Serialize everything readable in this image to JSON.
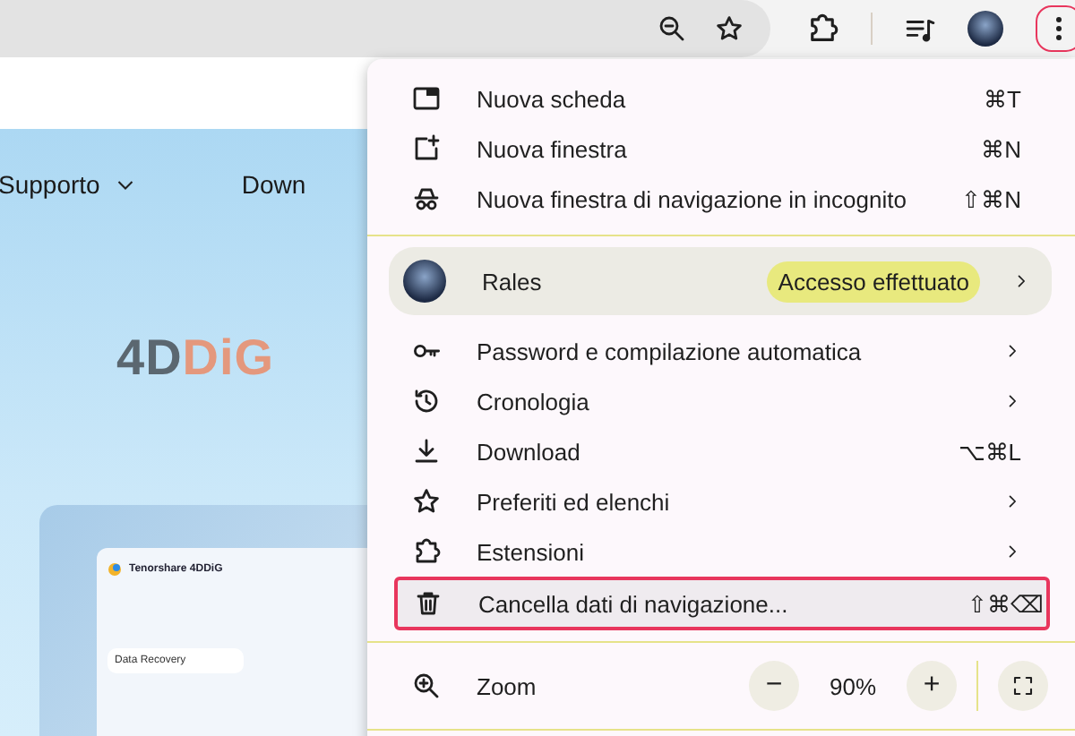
{
  "toolbar": {
    "menu_button": {
      "highlighted": true
    }
  },
  "page": {
    "nav": [
      {
        "label": "Supporto",
        "dropdown": true
      },
      {
        "label": "Down",
        "dropdown": false
      }
    ],
    "logo": {
      "dark": "4D",
      "accent": "DiG"
    },
    "preview": {
      "app_title": "Tenorshare 4DDiG",
      "tile_label": "Data Recovery"
    }
  },
  "menu": {
    "items": [
      {
        "kind": "item",
        "label": "Nuova scheda",
        "shortcut": "⌘T",
        "submenu": false,
        "highlighted": false
      },
      {
        "kind": "item",
        "label": "Nuova finestra",
        "shortcut": "⌘N",
        "submenu": false,
        "highlighted": false
      },
      {
        "kind": "item",
        "label": "Nuova finestra di navigazione in incognito",
        "shortcut": "⇧⌘N",
        "submenu": false,
        "highlighted": false
      },
      {
        "kind": "divider"
      },
      {
        "kind": "profile",
        "label": "Rales",
        "badge": "Accesso effettuato",
        "submenu": true
      },
      {
        "kind": "item",
        "label": "Password e compilazione automatica",
        "submenu": true,
        "highlighted": false
      },
      {
        "kind": "item",
        "label": "Cronologia",
        "submenu": true,
        "highlighted": false
      },
      {
        "kind": "item",
        "label": "Download",
        "shortcut": "⌥⌘L",
        "submenu": false,
        "highlighted": false
      },
      {
        "kind": "item",
        "label": "Preferiti ed elenchi",
        "submenu": true,
        "highlighted": false
      },
      {
        "kind": "item",
        "label": "Estensioni",
        "submenu": true,
        "highlighted": false
      },
      {
        "kind": "item",
        "label": "Cancella dati di navigazione...",
        "shortcut": "⇧⌘⌫",
        "submenu": false,
        "highlighted": true
      },
      {
        "kind": "divider"
      },
      {
        "kind": "zoom",
        "label": "Zoom",
        "minus": "−",
        "value": "90%",
        "plus": "+"
      },
      {
        "kind": "divider"
      }
    ]
  }
}
